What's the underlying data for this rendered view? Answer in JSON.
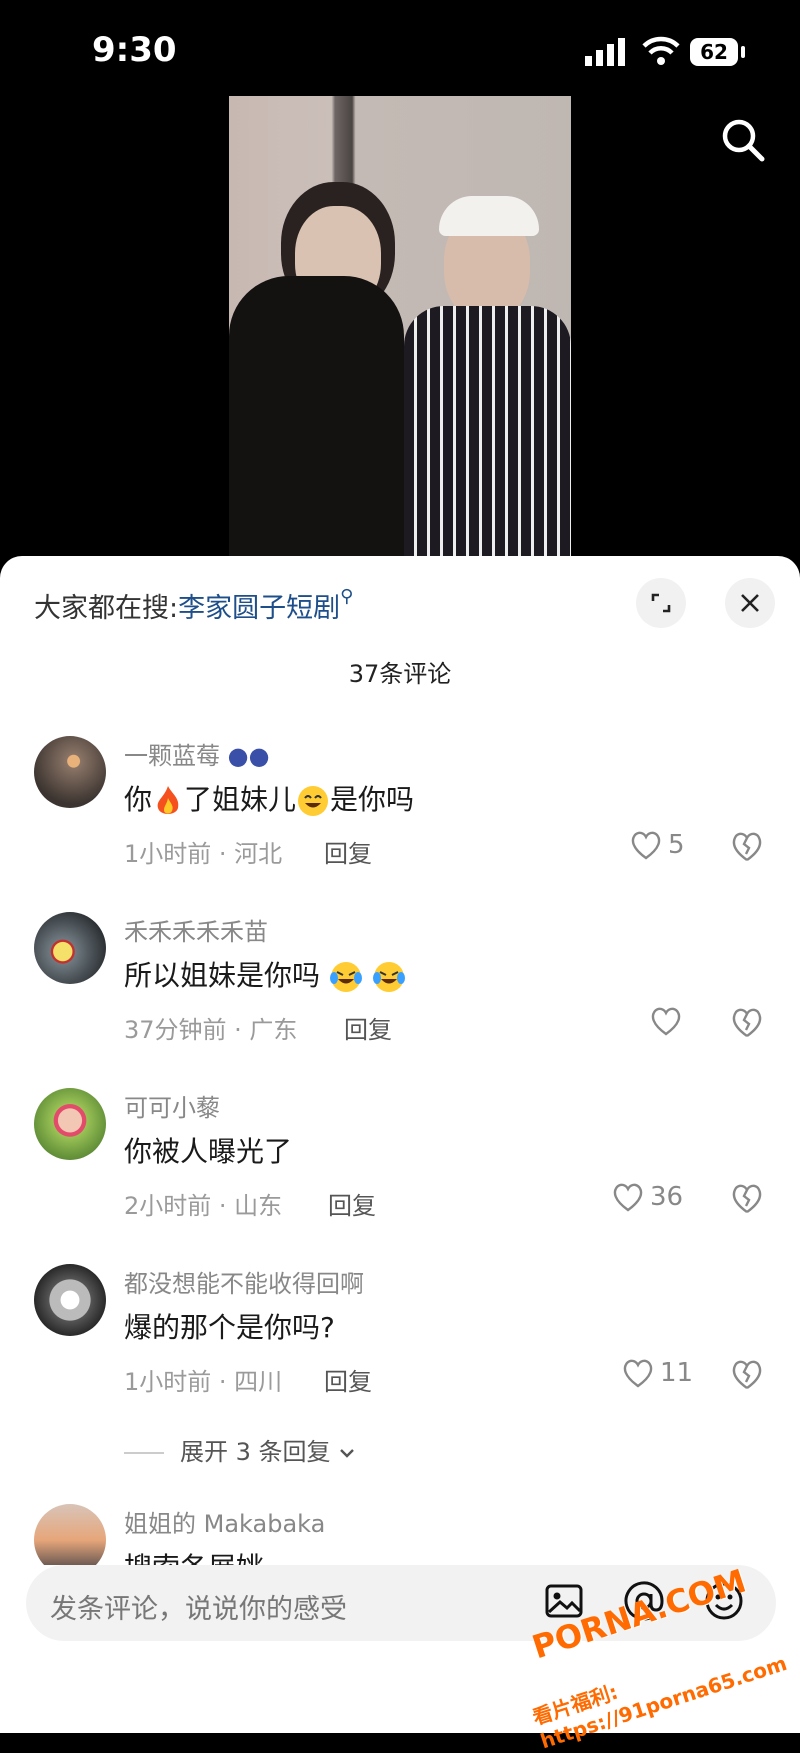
{
  "status_bar": {
    "time": "9:30",
    "battery": "62"
  },
  "search_suggest": {
    "prefix": "大家都在搜:",
    "keyword": "李家圆子短剧"
  },
  "comment_count": "37条评论",
  "comments": [
    {
      "user": "一颗蓝莓",
      "text_before": "你",
      "text_mid": "了姐妹儿",
      "text_after": "是你吗",
      "time_loc": "1小时前 · 河北",
      "reply": "回复",
      "likes": "5"
    },
    {
      "user": "禾禾禾禾禾苗",
      "text": "所以姐妹是你吗",
      "time_loc": "37分钟前 · 广东",
      "reply": "回复",
      "likes": ""
    },
    {
      "user": "可可小藜",
      "text": "你被人曝光了",
      "time_loc": "2小时前 · 山东",
      "reply": "回复",
      "likes": "36"
    },
    {
      "user": "都没想能不能收得回啊",
      "text": "爆的那个是你吗?",
      "time_loc": "1小时前 · 四川",
      "reply": "回复",
      "likes": "11"
    },
    {
      "user": "姐姐的 Makabaka",
      "text": "搜索各展姚",
      "time_loc": "",
      "reply": "",
      "likes": ""
    }
  ],
  "expand_replies": "展开 3 条回复",
  "input": {
    "placeholder": "发条评论，说说你的感受"
  },
  "watermark": {
    "logo": "PORNA.COM",
    "url": "看片福利: https://91porna65.com"
  }
}
